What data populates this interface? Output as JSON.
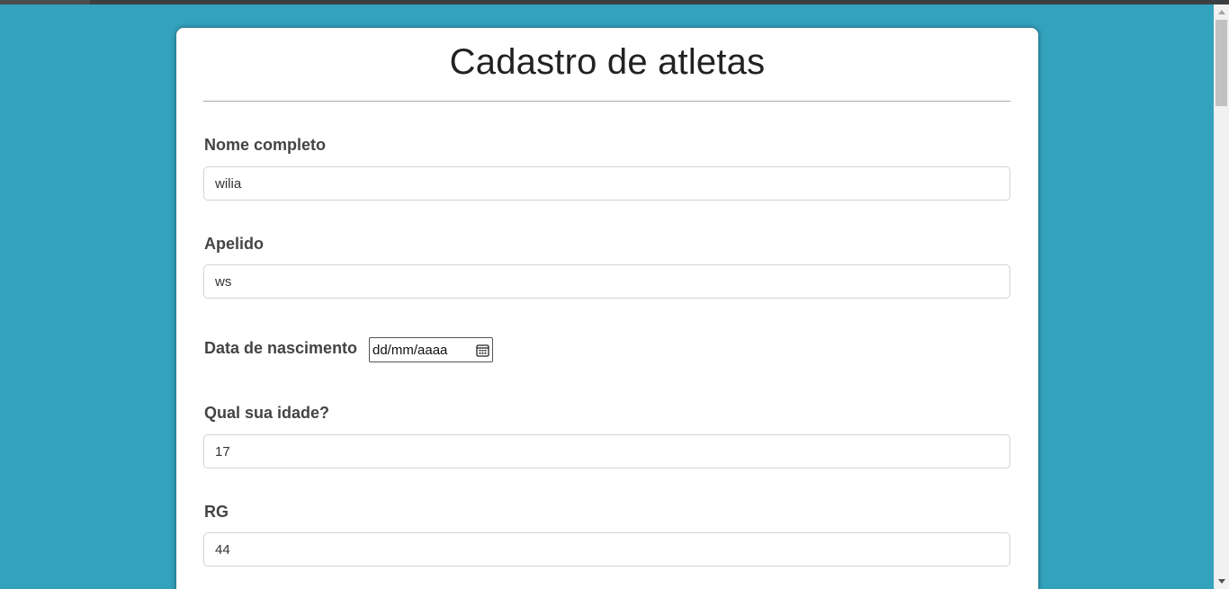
{
  "page": {
    "title": "Cadastro de atletas"
  },
  "form": {
    "nome": {
      "label": "Nome completo",
      "value": "wilia"
    },
    "apelido": {
      "label": "Apelido",
      "value": "ws"
    },
    "nascimento": {
      "label": "Data de nascimento",
      "value": "dd/mm/aaaa",
      "icon": "calendar-icon"
    },
    "idade": {
      "label": "Qual sua idade?",
      "value": "17"
    },
    "rg": {
      "label": "RG",
      "value": "44"
    }
  },
  "colors": {
    "background": "#33a2bd",
    "card": "#ffffff",
    "label": "#444444",
    "title": "#222222"
  }
}
